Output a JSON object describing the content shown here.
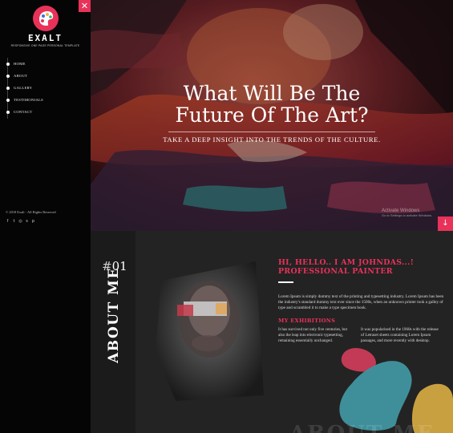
{
  "brand": {
    "name": "EXALT",
    "tagline": "RESPONSIVE ONE PAGE PERSONAL TEMPLATE",
    "close_symbol": "✕",
    "accent": "#e8325a"
  },
  "nav": {
    "items": [
      {
        "label": "HOME"
      },
      {
        "label": "ABOUT"
      },
      {
        "label": "GALLERY"
      },
      {
        "label": "TESTIMONIALS"
      },
      {
        "label": "CONTACT"
      }
    ]
  },
  "footer": {
    "copyright": "© 2018 Exalt - All Rights Reserved",
    "socials": [
      {
        "icon": "facebook-icon",
        "glyph": "f"
      },
      {
        "icon": "twitter-icon",
        "glyph": "t"
      },
      {
        "icon": "instagram-icon",
        "glyph": "◎"
      },
      {
        "icon": "skype-icon",
        "glyph": "s"
      },
      {
        "icon": "pinterest-icon",
        "glyph": "p"
      }
    ]
  },
  "hero": {
    "title_line1": "What Will Be The",
    "title_line2": "Future Of The Art?",
    "subtitle": "TAKE A DEEP INSIGHT INTO THE TRENDS OF THE CULTURE.",
    "scroll_symbol": "↓",
    "watermark_line1": "Activate Windows",
    "watermark_line2": "Go to Settings to activate Windows."
  },
  "about": {
    "number_hash": "#",
    "number": "01",
    "vertical_title": "ABOUT ME",
    "heading_line1": "HI, HELLO.. I AM JOHNDAS...!",
    "heading_line2": "PROFESSIONAL PAINTER",
    "paragraph": "Lorem Ipsum is simply dummy text of the printing and typesetting industry. Lorem Ipsum has been the industry's standard dummy text ever since the 1500s, when an unknown printer took a galley of type and scrambled it to make a type specimen book.",
    "exhibitions_title": "MY EXHIBITIONS",
    "exhibitions_col1": "It has survived not only five centuries, but also the leap into electronic typesetting, remaining essentially unchanged.",
    "exhibitions_col2": "It was popularised in the 1960s with the release of Letraset sheets containing Lorem Ipsum passages, and more recently with desktop.",
    "ghost_text": "ABOUT ME"
  }
}
